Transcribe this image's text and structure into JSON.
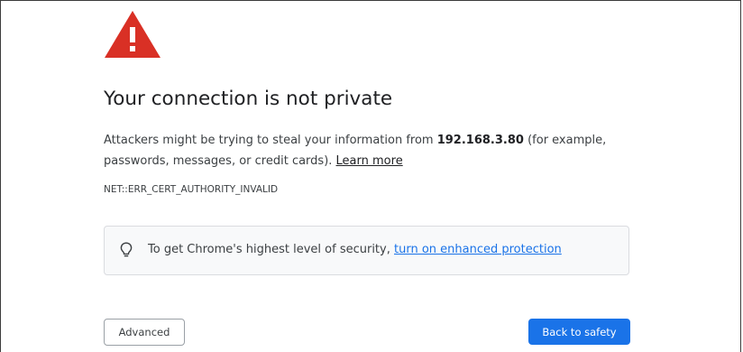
{
  "colors": {
    "warning_icon": "#d93025",
    "link": "#1a73e8",
    "primary_button": "#1a73e8"
  },
  "icons": {
    "warning": "warning-triangle-icon",
    "tip": "lightbulb-icon"
  },
  "interstitial": {
    "title": "Your connection is not private",
    "body_prefix": "Attackers might be trying to steal your information from ",
    "host": "192.168.3.80",
    "body_suffix": " (for example, passwords, messages, or credit cards). ",
    "learn_more": "Learn more",
    "error_code": "NET::ERR_CERT_AUTHORITY_INVALID"
  },
  "security_card": {
    "text": "To get Chrome's highest level of security, ",
    "link": "turn on enhanced protection"
  },
  "buttons": {
    "advanced": "Advanced",
    "back_to_safety": "Back to safety"
  }
}
